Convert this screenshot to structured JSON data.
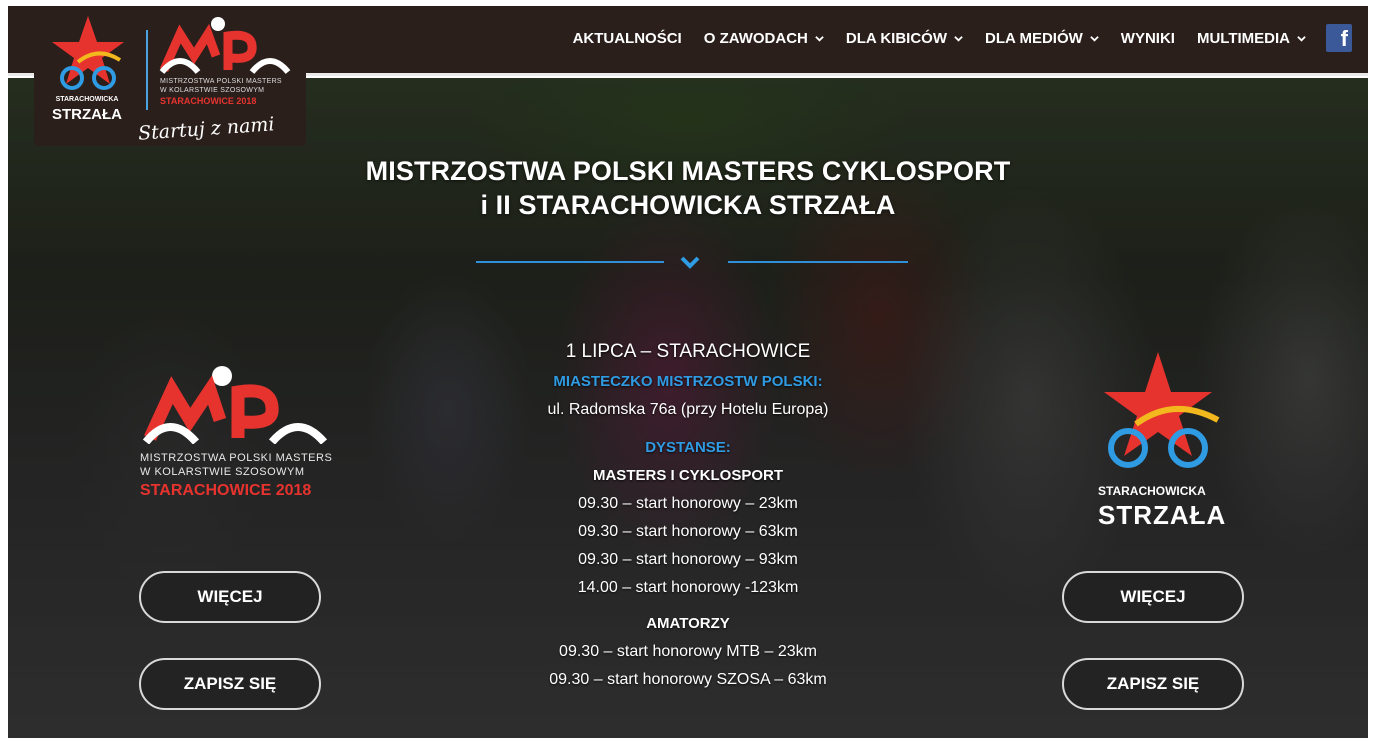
{
  "nav": {
    "items": [
      {
        "label": "AKTUALNOŚCI",
        "has_dropdown": false
      },
      {
        "label": "O ZAWODACH",
        "has_dropdown": true
      },
      {
        "label": "DLA KIBICÓW",
        "has_dropdown": true
      },
      {
        "label": "DLA MEDIÓW",
        "has_dropdown": true
      },
      {
        "label": "WYNIKI",
        "has_dropdown": false
      },
      {
        "label": "MULTIMEDIA",
        "has_dropdown": true
      }
    ],
    "facebook_icon": "facebook-icon",
    "facebook_glyph": "f"
  },
  "header_logo": {
    "strzala_small": "STARACHOWICKA",
    "strzala_big": "STRZAŁA",
    "mp_line1": "MISTRZOSTWA POLSKI MASTERS",
    "mp_line2": "W KOLARSTWIE SZOSOWYM",
    "mp_city": "STARACHOWICE 2018",
    "slogan": "Startuj z nami"
  },
  "hero": {
    "title_line1": "MISTRZOSTWA POLSKI MASTERS CYKLOSPORT",
    "title_line2": "i II STARACHOWICKA STRZAŁA",
    "date_place": "1 LIPCA – STARACHOWICE",
    "venue_label": "MIASTECZKO MISTRZOSTW POLSKI:",
    "venue_address": "ul. Radomska 76a (przy Hotelu Europa)",
    "distances_label": "DYSTANSE:",
    "masters_heading": "MASTERS I CYKLOSPORT",
    "masters_items": [
      "09.30 – start honorowy – 23km",
      "09.30 – start honorowy – 63km",
      "09.30 –  start honorowy – 93km",
      "14.00 – start honorowy -123km"
    ],
    "amateurs_heading": "AMATORZY",
    "amateurs_items": [
      "09.30 – start honorowy MTB – 23km",
      "09.30 – start honorowy SZOSA – 63km"
    ]
  },
  "left_logo": {
    "line1": "MISTRZOSTWA POLSKI MASTERS",
    "line2": "W KOLARSTWIE SZOSOWYM",
    "city": "STARACHOWICE 2018"
  },
  "right_logo": {
    "small": "STARACHOWICKA",
    "big": "STRZAŁA"
  },
  "buttons": {
    "left_more": "WIĘCEJ",
    "left_signup": "ZAPISZ SIĘ",
    "right_more": "WIĘCEJ",
    "right_signup": "ZAPISZ SIĘ"
  },
  "colors": {
    "nav_bg": "#2b1f1c",
    "accent_blue": "#2f9be3",
    "accent_red": "#e7332e",
    "facebook": "#3b5998"
  }
}
